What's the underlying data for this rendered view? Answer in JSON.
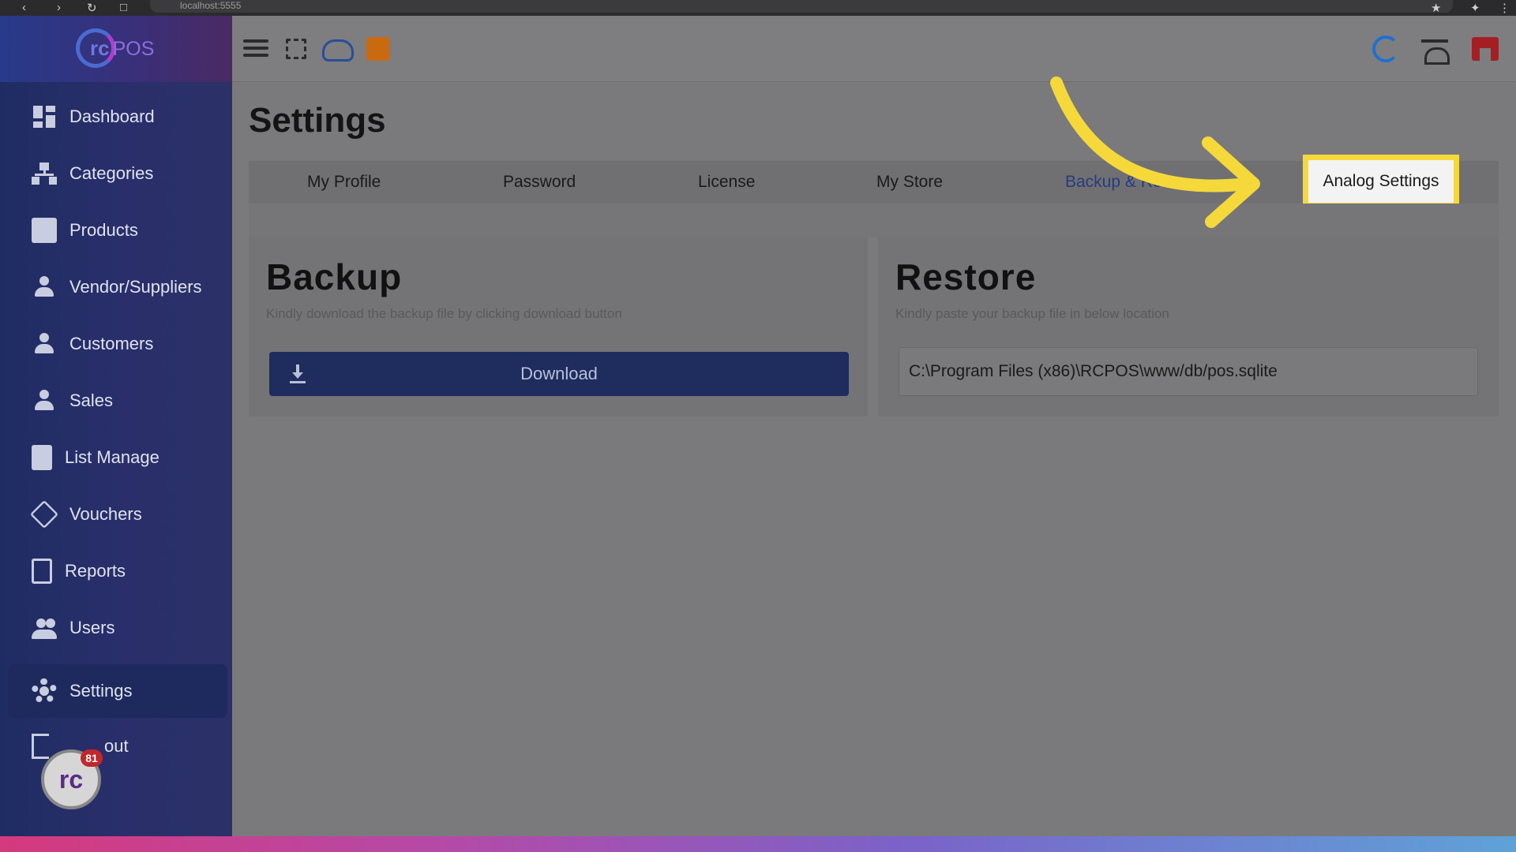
{
  "browser": {
    "url": "localhost:5555"
  },
  "brand": {
    "logo_initials": "rc",
    "logo_suffix": "POS"
  },
  "sidebar": {
    "items": [
      {
        "label": "Dashboard",
        "icon": "dashboard-icon"
      },
      {
        "label": "Categories",
        "icon": "categories-icon"
      },
      {
        "label": "Products",
        "icon": "products-icon"
      },
      {
        "label": "Vendor/Suppliers",
        "icon": "vendor-icon"
      },
      {
        "label": "Customers",
        "icon": "customer-icon"
      },
      {
        "label": "Sales",
        "icon": "sales-icon"
      },
      {
        "label": "List Manage",
        "icon": "clipboard-icon"
      },
      {
        "label": "Vouchers",
        "icon": "tag-icon"
      },
      {
        "label": "Reports",
        "icon": "report-icon"
      },
      {
        "label": "Users",
        "icon": "users-icon"
      },
      {
        "label": "Settings",
        "icon": "gear-icon",
        "active": true
      },
      {
        "label": "out",
        "icon": "logout-icon"
      }
    ],
    "badge": {
      "initials": "rc",
      "count": "81"
    }
  },
  "topbar": {
    "left_icons": [
      "menu-icon",
      "fullscreen-icon",
      "cloud-print-icon",
      "wallet-icon"
    ],
    "right_icons": [
      "sync-icon",
      "scale-icon",
      "store-icon"
    ]
  },
  "page": {
    "title": "Settings"
  },
  "tabs": [
    {
      "label": "My Profile"
    },
    {
      "label": "Password"
    },
    {
      "label": "License"
    },
    {
      "label": "My Store"
    },
    {
      "label": "Backup & Re",
      "active": true
    },
    {
      "label": "Analog Settings",
      "highlighted": true
    }
  ],
  "backup": {
    "title": "Backup",
    "description": "Kindly download the backup file by clicking download button",
    "button_label": "Download"
  },
  "restore": {
    "title": "Restore",
    "description": "Kindly paste your backup file in below location",
    "path_value": "C:\\Program Files (x86)\\RCPOS\\www/db/pos.sqlite"
  },
  "colors": {
    "sidebar": "#2a2f6b",
    "accent_blue": "#1e2c5e",
    "highlight_yellow": "#f5d93a",
    "badge_red": "#c3262b"
  }
}
